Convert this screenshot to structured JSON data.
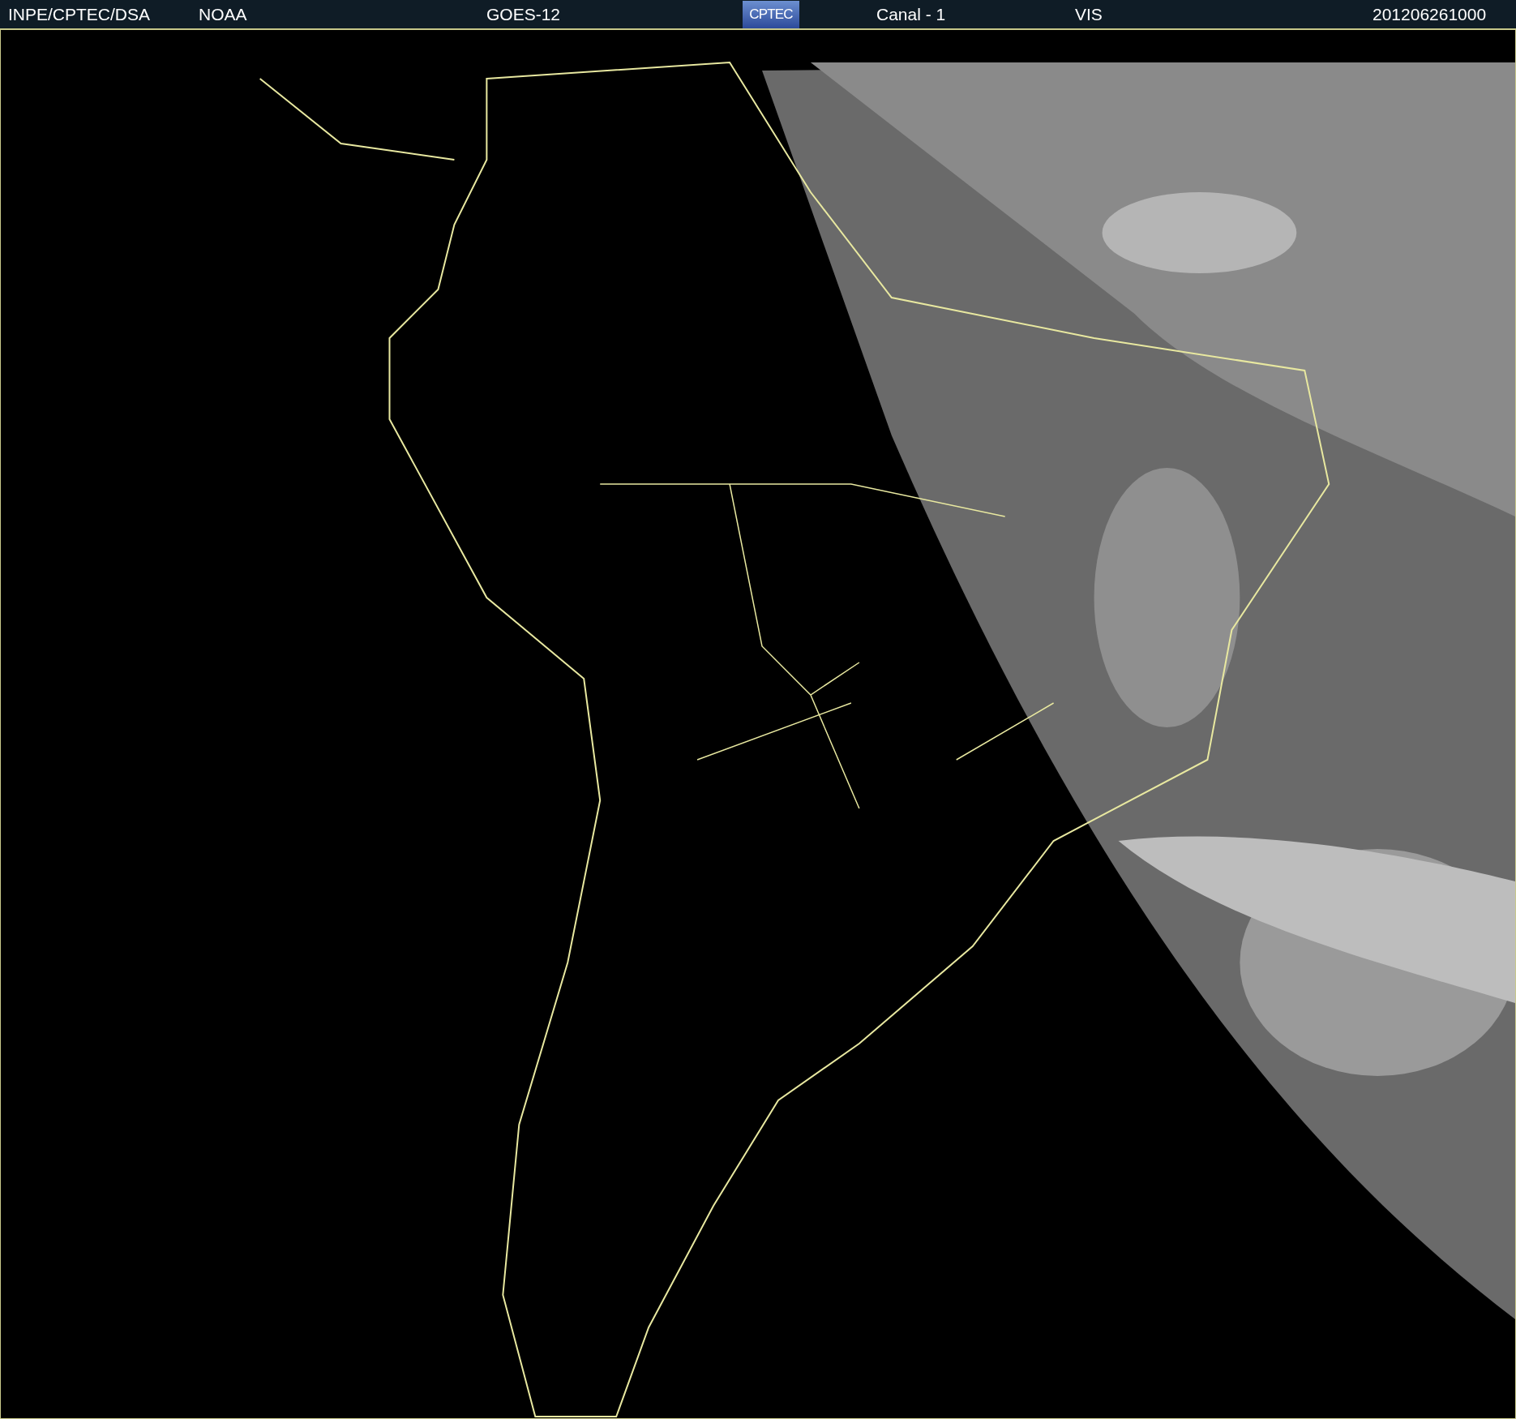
{
  "header": {
    "source": "INPE/CPTEC/DSA",
    "agency": "NOAA",
    "satellite": "GOES-12",
    "logo": "CPTEC",
    "channel": "Canal - 1",
    "band": "VIS",
    "timestamp": "201206261000"
  }
}
